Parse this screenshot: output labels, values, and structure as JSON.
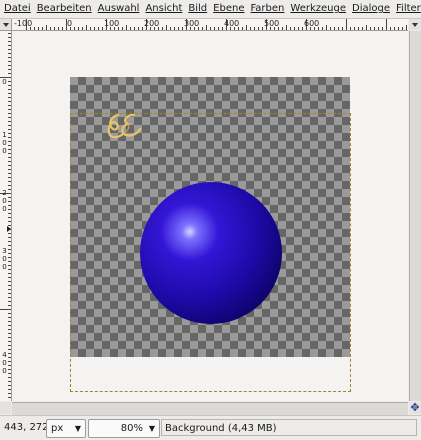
{
  "menu": [
    "Datei",
    "Bearbeiten",
    "Auswahl",
    "Ansicht",
    "Bild",
    "Ebene",
    "Farben",
    "Werkzeuge",
    "Dialoge",
    "Filter"
  ],
  "hruler_labels": [
    "-100",
    "0",
    "100",
    "200",
    "300",
    "400",
    "500",
    "600",
    "700"
  ],
  "vruler_labels": [
    "0",
    "100",
    "200",
    "300",
    "400"
  ],
  "status": {
    "coords": "443, 272",
    "unit": "px",
    "zoom": "80%",
    "layer_info": "Background (4,43 MB)"
  },
  "icons": {
    "navigate": "navigate-icon",
    "zoom": "zoom-icon"
  },
  "colors": {
    "sphere": "#1d0aa8",
    "selection": "#a0852a"
  }
}
